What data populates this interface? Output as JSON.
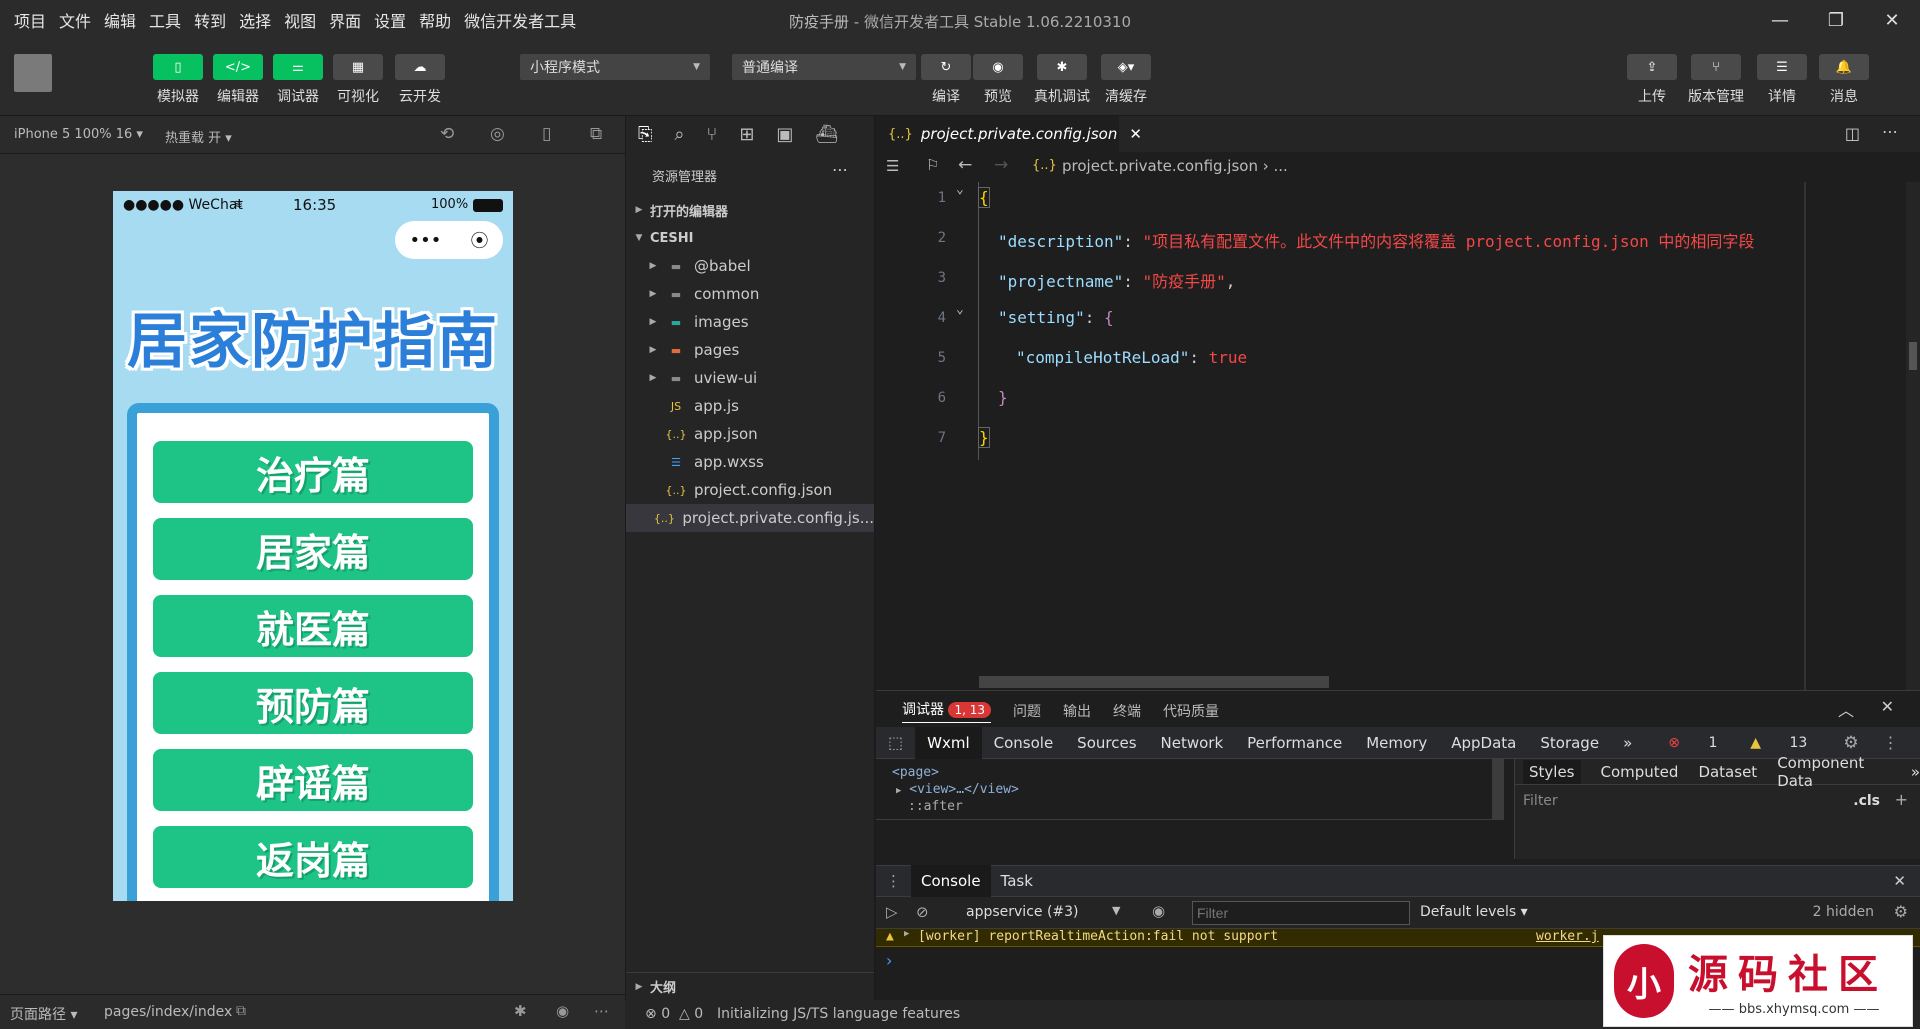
{
  "menu": [
    "项目",
    "文件",
    "编辑",
    "工具",
    "转到",
    "选择",
    "视图",
    "界面",
    "设置",
    "帮助",
    "微信开发者工具"
  ],
  "window": {
    "project": "防疫手册",
    "separator": " - ",
    "app": "微信开发者工具 Stable 1.06.2210310"
  },
  "toolbar": {
    "simulator": "模拟器",
    "editor": "编辑器",
    "debugger": "调试器",
    "visual": "可视化",
    "cloud": "云开发",
    "mode": "小程序模式",
    "compile_mode": "普通编译",
    "compile": "编译",
    "preview": "预览",
    "remote_debug": "真机调试",
    "clear_cache": "清缓存",
    "upload": "上传",
    "version": "版本管理",
    "details": "详情",
    "messages": "消息"
  },
  "simbar": {
    "device": "iPhone 5 100% 16",
    "hotreload": "热重载 开"
  },
  "phone": {
    "carrier": "●●●●● WeChat",
    "time": "16:35",
    "battery": "100%",
    "title": "居家防护指南",
    "buttons": [
      "治疗篇",
      "居家篇",
      "就医篇",
      "预防篇",
      "辟谣篇",
      "返岗篇"
    ]
  },
  "simfoot": {
    "label": "页面路径",
    "path": "pages/index/index"
  },
  "explorer": {
    "title": "资源管理器",
    "open_editors": "打开的编辑器",
    "root": "CESHI",
    "items": [
      {
        "name": "@babel",
        "type": "folder"
      },
      {
        "name": "common",
        "type": "folder"
      },
      {
        "name": "images",
        "type": "folder"
      },
      {
        "name": "pages",
        "type": "folder"
      },
      {
        "name": "uview-ui",
        "type": "folder"
      },
      {
        "name": "app.js",
        "type": "js"
      },
      {
        "name": "app.json",
        "type": "json"
      },
      {
        "name": "app.wxss",
        "type": "css"
      },
      {
        "name": "project.config.json",
        "type": "json"
      },
      {
        "name": "project.private.config.js...",
        "type": "json"
      }
    ],
    "outline": "大纲"
  },
  "editor": {
    "tab": "project.private.config.json",
    "crumb": "project.private.config.json",
    "crumb_more": "...",
    "lines": [
      "1",
      "2",
      "3",
      "4",
      "5",
      "6",
      "7"
    ],
    "code": {
      "desc_key": "\"description\"",
      "desc_val": "\"项目私有配置文件。此文件中的内容将覆盖 project.config.json 中的相同字段",
      "name_key": "\"projectname\"",
      "name_val": "\"防疫手册\"",
      "setting_key": "\"setting\"",
      "hot_key": "\"compileHotReLoad\"",
      "hot_val": "true"
    }
  },
  "debug": {
    "tabs": [
      "调试器",
      "问题",
      "输出",
      "终端",
      "代码质量"
    ],
    "badge": "1, 13",
    "devtabs": [
      "Wxml",
      "Console",
      "Sources",
      "Network",
      "Performance",
      "Memory",
      "AppData",
      "Storage"
    ],
    "errors": "1",
    "warnings": "13",
    "wxml": [
      "<page>",
      "<view>…</view>",
      "::after"
    ],
    "styletabs": [
      "Styles",
      "Computed",
      "Dataset",
      "Component Data"
    ],
    "filter": "Filter",
    "cls": ".cls",
    "console_tabs": [
      "Console",
      "Task"
    ],
    "context": "appservice (#3)",
    "filter_ph": "Filter",
    "levels": "Default levels",
    "hidden": "2 hidden",
    "warn": "[worker] reportRealtimeAction:fail not support",
    "warn_src": "worker.j",
    "prompt": "›"
  },
  "status": {
    "errors": "0",
    "warnings": "0",
    "msg": "Initializing JS/TS language features"
  },
  "watermark": {
    "title": "源码社区",
    "url": "bbs.xhymsq.com",
    "logo": "小"
  }
}
